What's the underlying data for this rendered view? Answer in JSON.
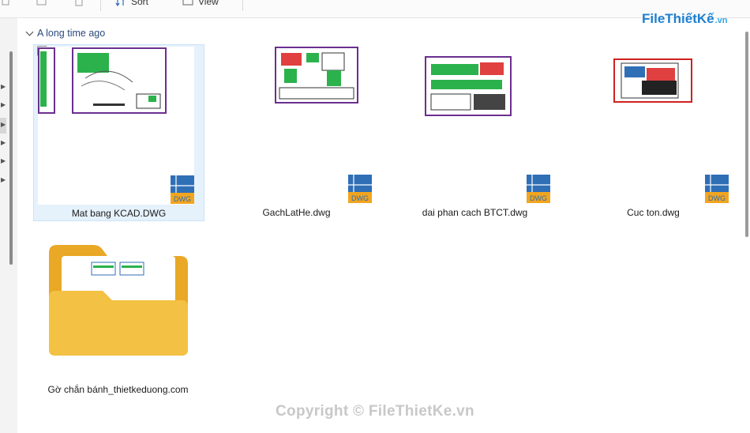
{
  "toolbar": {
    "sort_label": "Sort",
    "view_label": "View"
  },
  "brand": {
    "name": "FileThiếtKế",
    "suffix": ".vn"
  },
  "group": {
    "title": "A long time ago"
  },
  "files": [
    {
      "name": "Mat bang KCAD.DWG",
      "type_badge": "DWG",
      "selected": true
    },
    {
      "name": "GachLatHe.dwg",
      "type_badge": "DWG",
      "selected": false
    },
    {
      "name": "dai phan cach BTCT.dwg",
      "type_badge": "DWG",
      "selected": false
    },
    {
      "name": "Cuc ton.dwg",
      "type_badge": "DWG",
      "selected": false
    }
  ],
  "folder": {
    "name": "Gờ chắn bánh_thietkeduong.com"
  },
  "watermark": {
    "text": "Copyright © FileThietKe.vn"
  },
  "colors": {
    "selection_bg": "#e5f1fb",
    "folder_yellow": "#f3c143",
    "dwg_blue": "#2f6fb6",
    "dwg_orange": "#f2a51f",
    "link_blue": "#2b4a7a"
  }
}
